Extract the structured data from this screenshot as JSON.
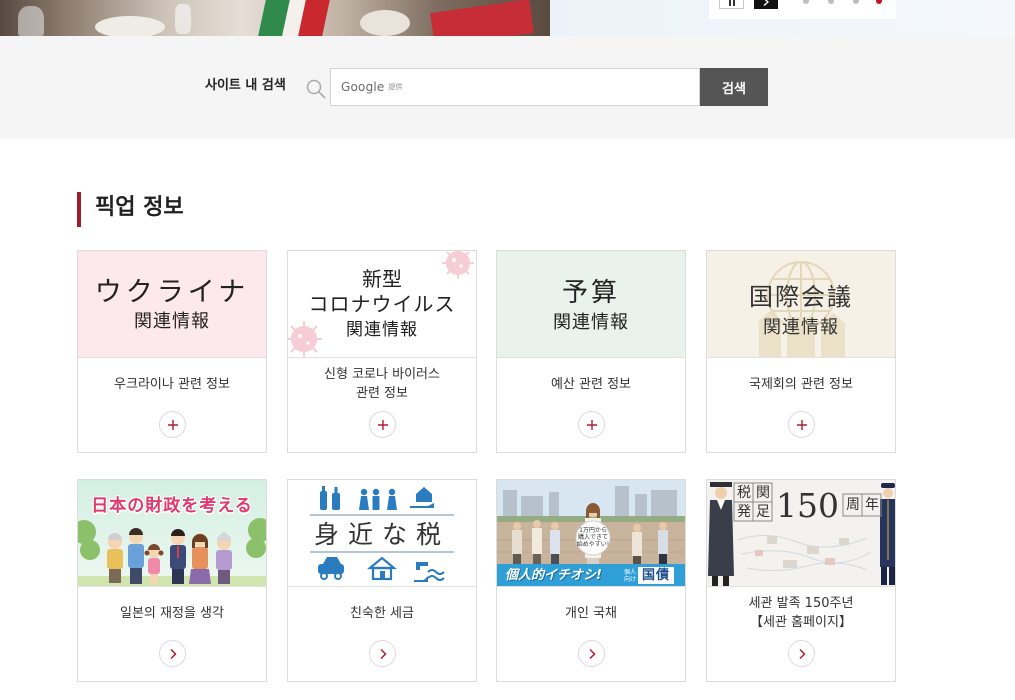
{
  "hero": {
    "slider": {
      "pause_icon": "pause-icon",
      "next_icon": "chevron-right-icon",
      "active_dot_color": "#c8102e"
    }
  },
  "search": {
    "label": "사이트 내 검색",
    "icon": "search-icon",
    "provider_name": "Google",
    "provider_suffix": "提供",
    "button_label": "검색"
  },
  "pickup": {
    "heading": "픽업 정보",
    "cards": [
      {
        "image_text": [
          "ウクライナ",
          "関連情報"
        ],
        "label": "우크라이나 관련 정보",
        "action_icon": "plus-icon"
      },
      {
        "image_text": [
          "新型",
          "コロナウイルス",
          "関連情報"
        ],
        "label": "신형 코로나 바이러스\n관련 정보",
        "action_icon": "plus-icon"
      },
      {
        "image_text": [
          "予算",
          "関連情報"
        ],
        "label": "예산 관련 정보",
        "action_icon": "plus-icon"
      },
      {
        "image_text": [
          "国際会議",
          "関連情報"
        ],
        "label": "국제회의 관련 정보",
        "action_icon": "plus-icon"
      },
      {
        "image_text": [
          "日本の財政を考える"
        ],
        "label": "일본의 재정을 생각",
        "action_icon": "chevron-right-icon"
      },
      {
        "image_text": [
          "身近な税"
        ],
        "label": "친숙한 세금",
        "action_icon": "chevron-right-icon"
      },
      {
        "image_text": [
          "個人的イチオシ!",
          "個人",
          "向け",
          "国債",
          "1万円から",
          "購入できて",
          "始めやすい!"
        ],
        "label": "개인 국채",
        "action_icon": "chevron-right-icon"
      },
      {
        "image_text": [
          "税",
          "関",
          "発",
          "足",
          "150",
          "周",
          "年"
        ],
        "label": "세관 발족 150주년\n【세관 홈페이지】",
        "action_icon": "chevron-right-icon"
      }
    ]
  },
  "colors": {
    "accent": "#9e1b32",
    "action_icon": "#b01e30",
    "search_button": "#555555",
    "search_band": "#f5f5f5",
    "card_border": "#dcdcdc"
  }
}
